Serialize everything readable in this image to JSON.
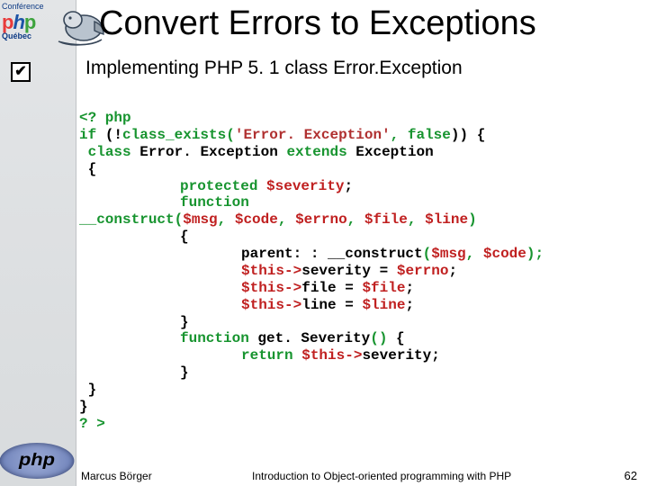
{
  "logo": {
    "top_word": "Conférence",
    "php_p1": "p",
    "php_h": "h",
    "php_p2": "p",
    "region": "Québec"
  },
  "title": "Convert Errors to Exceptions",
  "check_glyph": "✔",
  "subtitle": "Implementing PHP 5. 1 class Error.Exception",
  "footer": {
    "author": "Marcus Börger",
    "title": "Introduction to Object-oriented programming with PHP",
    "page": "62"
  },
  "php_logo_text": "php",
  "code": {
    "open_tag": "<? php",
    "if_kw": "if ",
    "if_cond1": "(!",
    "if_fn": "class_exists",
    "if_paren": "(",
    "if_str": "'Error. Exception'",
    "if_comma": ", ",
    "if_false": "false",
    "if_close": ")) {",
    "class_kw": "class",
    "class_line": " Error. Exception ",
    "extends_kw": "extends ",
    "exception_word": "Exception",
    "open_brace": "{",
    "protected_kw": "protected ",
    "severity_var": "$severity",
    "semicolon": ";",
    "function_kw": "function",
    "construct_name": "__construct",
    "construct_params_open": "(",
    "p_msg": "$msg",
    "p_code": "$code",
    "p_errno": "$errno",
    "p_file": "$file",
    "p_line": "$line",
    "construct_params_close": ")",
    "parent_call": "parent: : __construct",
    "parent_args_open": "(",
    "p2_msg": "$msg",
    "p2_code": "$code",
    "parent_args_close": ");",
    "this": "$this",
    "arrow": "->",
    "sev_prop": "severity = ",
    "errno": "$errno",
    "file_prop": "file = ",
    "file": "$file",
    "line_prop": "line = ",
    "line": "$line",
    "getsev_decl": "function",
    "getsev_name": " get. Severity",
    "getsev_paren": "()",
    "getsev_brace": " {",
    "return_kw": "return ",
    "ret_this": "$this",
    "ret_arrow": "->",
    "ret_prop": "severity",
    "close_brace": "}",
    "close_tag": "? >"
  }
}
